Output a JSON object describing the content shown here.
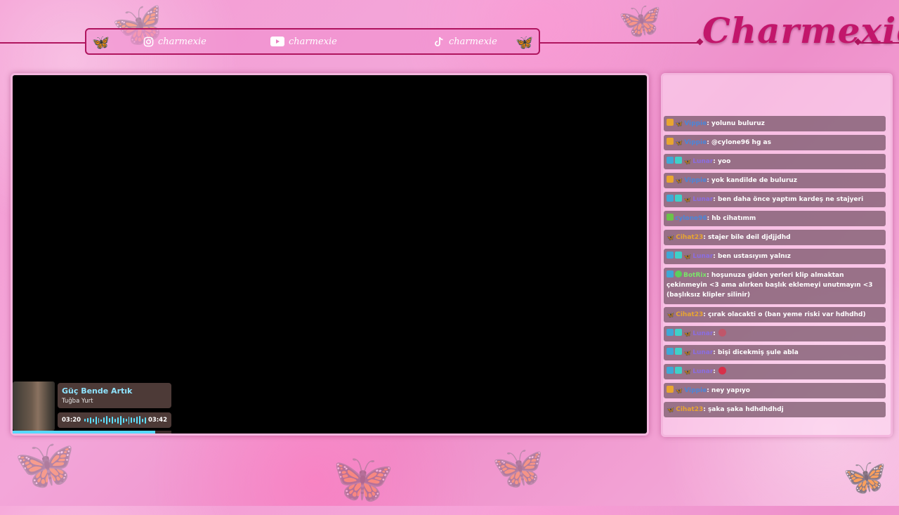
{
  "brand": {
    "name": "Charmexie"
  },
  "socials": [
    {
      "platform_icon": "instagram-icon",
      "handle": "charmexie"
    },
    {
      "platform_icon": "youtube-icon",
      "handle": "charmexie"
    },
    {
      "platform_icon": "tiktok-icon",
      "handle": "charmexie"
    }
  ],
  "music": {
    "title": "Güç Bende Artık",
    "artist": "Tuğba Yurt",
    "elapsed": "03:20",
    "duration": "03:42",
    "progress": 0.9
  },
  "chat": [
    {
      "user": "Vippie",
      "color": "#4a86d8",
      "badges": [
        "crown",
        "butterfly"
      ],
      "text": ": yolunu buluruz"
    },
    {
      "user": "Vippie",
      "color": "#4a86d8",
      "badges": [
        "crown",
        "butterfly"
      ],
      "text": ": @cylone96 hg as"
    },
    {
      "user": "Lunar",
      "color": "#8a6de0",
      "badges": [
        "blue",
        "teal",
        "butterfly"
      ],
      "text": ": yoo"
    },
    {
      "user": "Vippie",
      "color": "#4a86d8",
      "badges": [
        "crown",
        "butterfly"
      ],
      "text": ": yok kandilde de buluruz"
    },
    {
      "user": "Lunar",
      "color": "#8a6de0",
      "badges": [
        "blue",
        "teal",
        "butterfly"
      ],
      "text": ": ben daha önce yaptım kardeş ne stajyeri"
    },
    {
      "user": "cylone96",
      "color": "#4a86d8",
      "badges": [
        "green"
      ],
      "text": ": hb cihatımm"
    },
    {
      "user": "Cihat23",
      "color": "#e8a531",
      "badges": [
        "butterfly"
      ],
      "text": ": stajer bile deil djdjjdhd"
    },
    {
      "user": "Lunar",
      "color": "#8a6de0",
      "badges": [
        "blue",
        "teal",
        "butterfly"
      ],
      "text": ": ben ustasıyım yalnız"
    },
    {
      "user": "BotRix",
      "color": "#7be36b",
      "badges": [
        "blue",
        "circle"
      ],
      "text": ": hoşunuza giden yerleri klip almaktan çekinmeyin <3 ama alırken başlık eklemeyi unutmayın <3 (başlıksız klipler silinir)"
    },
    {
      "user": "Cihat23",
      "color": "#e8a531",
      "badges": [
        "butterfly"
      ],
      "text": ": çırak olacakti o (ban yeme riski var hdhdhd)"
    },
    {
      "user": "Lunar",
      "color": "#8a6de0",
      "badges": [
        "blue",
        "teal",
        "butterfly"
      ],
      "text": ":",
      "emote": "#c0566a"
    },
    {
      "user": "Lunar",
      "color": "#8a6de0",
      "badges": [
        "blue",
        "teal",
        "butterfly"
      ],
      "text": ": bişi dicekmiş şule abla"
    },
    {
      "user": "Lunar",
      "color": "#8a6de0",
      "badges": [
        "blue",
        "teal",
        "butterfly"
      ],
      "text": ":",
      "emote": "#d8304a"
    },
    {
      "user": "Vippie",
      "color": "#4a86d8",
      "badges": [
        "crown",
        "butterfly"
      ],
      "text": ": ney yapıyo"
    },
    {
      "user": "Cihat23",
      "color": "#e8a531",
      "badges": [
        "butterfly"
      ],
      "text": ": şaka şaka hdhdhdhdj"
    }
  ]
}
